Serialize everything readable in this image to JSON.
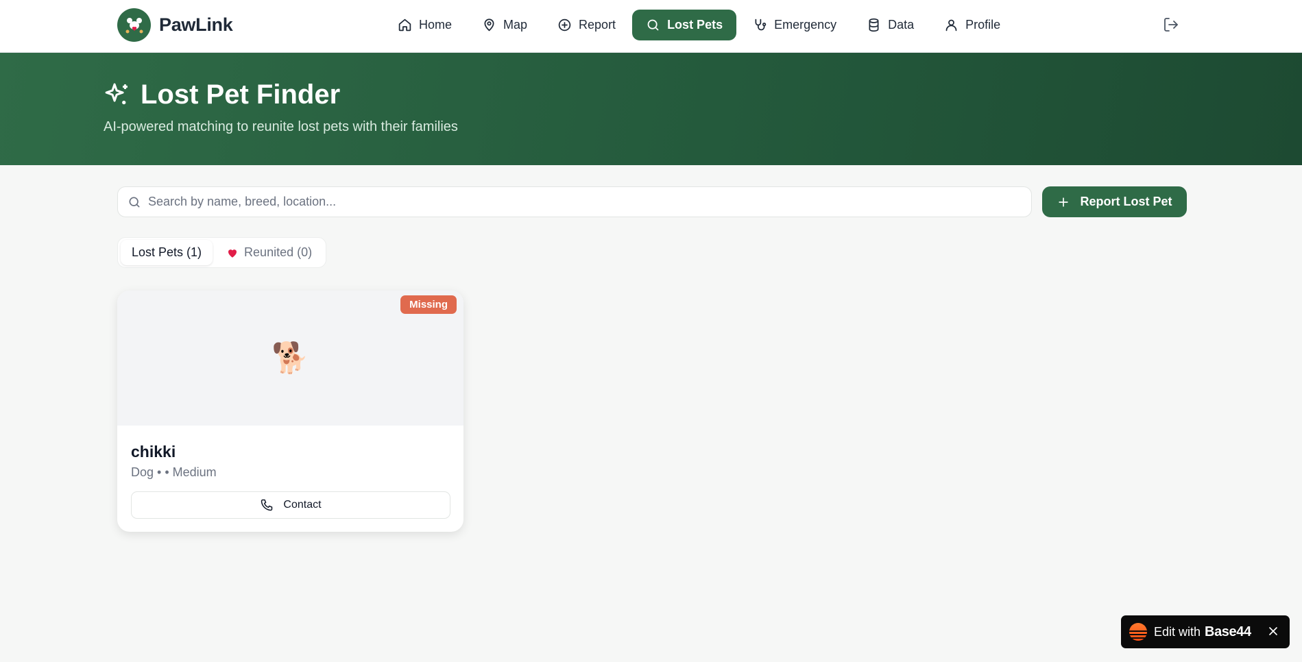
{
  "brand": {
    "name": "PawLink"
  },
  "nav": {
    "items": [
      {
        "label": "Home",
        "icon": "home-icon"
      },
      {
        "label": "Map",
        "icon": "map-pin-icon"
      },
      {
        "label": "Report",
        "icon": "plus-circle-icon"
      },
      {
        "label": "Lost Pets",
        "icon": "search-icon",
        "active": true
      },
      {
        "label": "Emergency",
        "icon": "stethoscope-icon"
      },
      {
        "label": "Data",
        "icon": "database-icon"
      },
      {
        "label": "Profile",
        "icon": "user-icon"
      }
    ],
    "logout_icon": "logout-icon"
  },
  "hero": {
    "title": "Lost Pet Finder",
    "subtitle": "AI-powered matching to reunite lost pets with their families",
    "icon": "sparkles-icon"
  },
  "search": {
    "placeholder": "Search by name, breed, location...",
    "value": ""
  },
  "actions": {
    "report_label": "Report Lost Pet"
  },
  "tabs": [
    {
      "label": "Lost Pets (1)",
      "active": true
    },
    {
      "label": "Reunited (0)",
      "icon": "heart-icon"
    }
  ],
  "pets": [
    {
      "emoji": "🐕",
      "status": "Missing",
      "name": "chikki",
      "meta": "Dog • • Medium",
      "contact_label": "Contact"
    }
  ],
  "floating": {
    "text": "Edit with",
    "brand": "Base44"
  },
  "colors": {
    "primary": "#2f6b47",
    "badge": "#e06a4e",
    "heart": "#e11d48"
  }
}
